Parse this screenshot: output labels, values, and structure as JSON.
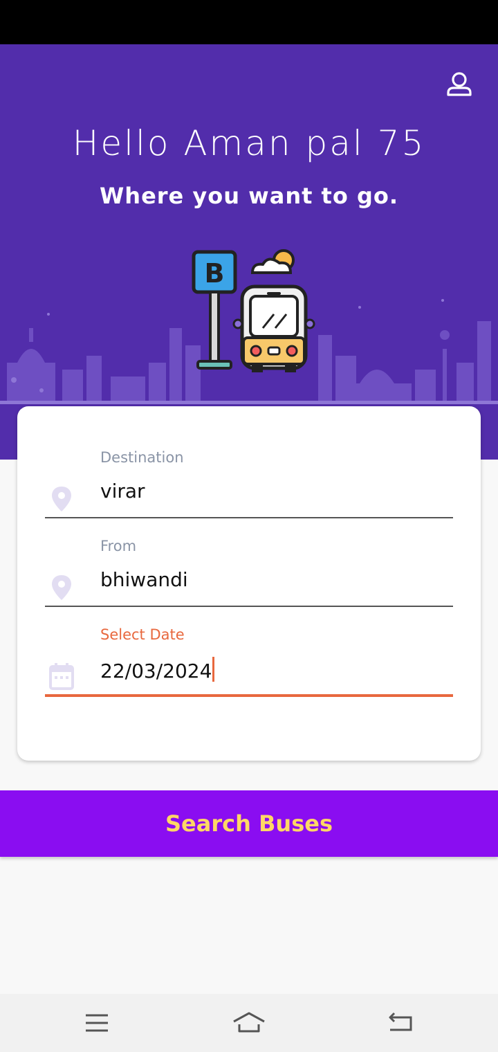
{
  "header": {
    "greeting": "Hello Aman pal 75",
    "subtitle": "Where you want to go.",
    "bus_stop_sign_letter": "B"
  },
  "form": {
    "destination": {
      "label": "Destination",
      "value": "virar",
      "icon": "location-pin-icon"
    },
    "from": {
      "label": "From",
      "value": "bhiwandi",
      "icon": "location-pin-icon"
    },
    "date": {
      "label": "Select Date",
      "value": "22/03/2024",
      "icon": "calendar-icon"
    }
  },
  "actions": {
    "search_label": "Search Buses"
  },
  "colors": {
    "header_bg": "#522dab",
    "button_bg": "#8a0df1",
    "button_text": "#ffd766",
    "accent": "#e8683e"
  },
  "icons": {
    "profile": "person-icon",
    "nav_menu": "menu-icon",
    "nav_home": "home-icon",
    "nav_back": "back-icon"
  }
}
